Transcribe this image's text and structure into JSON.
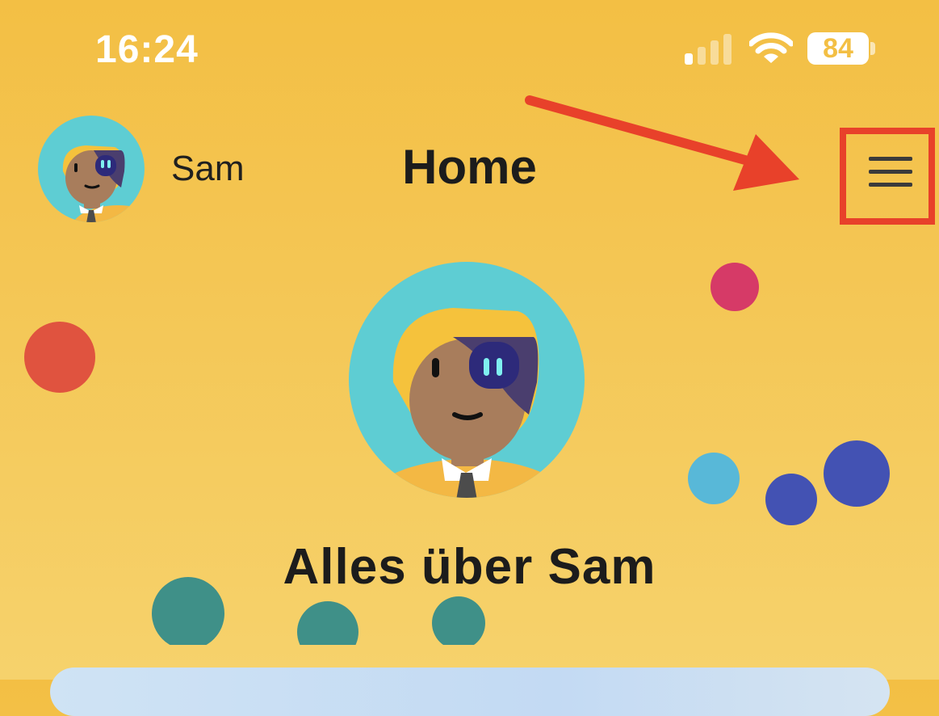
{
  "status_bar": {
    "time": "16:24",
    "battery": "84",
    "icons": [
      "cellular-signal-icon",
      "wifi-icon",
      "battery-icon"
    ]
  },
  "header": {
    "user_name": "Sam",
    "title": "Home",
    "menu_icon": "hamburger-menu-icon"
  },
  "annotation": {
    "arrow_color": "#e8412a",
    "highlight_color": "#e8412a"
  },
  "profile": {
    "heading": "Alles über Sam"
  },
  "colors": {
    "background": "#f3bf44",
    "avatar_ring": "#5ecdd3",
    "dot_red": "#e0533f",
    "dot_pink": "#d63a67",
    "dot_blue_light": "#58b8d8",
    "dot_blue_dark": "#4352b3",
    "dot_teal": "#3f9088"
  }
}
